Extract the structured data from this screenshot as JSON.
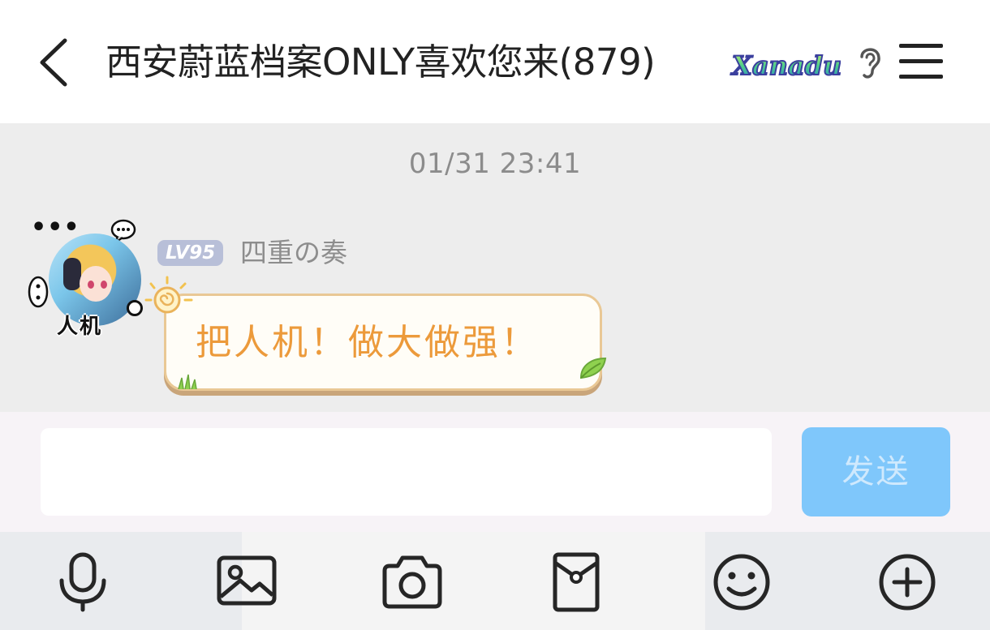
{
  "header": {
    "back_icon": "chevron-left-icon",
    "title": "西安蔚蓝档案ONLY喜欢您来(879)",
    "badge_text": "Xanadu",
    "ear_icon": "ear-icon",
    "menu_icon": "hamburger-menu-icon"
  },
  "chat": {
    "timestamp": "01/31 23:41",
    "messages": [
      {
        "avatar_tag": "人机",
        "level": "LV95",
        "sender": "四重の奏",
        "text": "把人机！做大做强！",
        "text_color": "#ec9a3b"
      }
    ]
  },
  "composer": {
    "input_value": "",
    "send_label": "发送",
    "send_color": "#7fc7fb"
  },
  "toolbar": {
    "items": [
      "microphone-icon",
      "image-icon",
      "camera-icon",
      "red-envelope-icon",
      "emoji-icon",
      "plus-circle-icon"
    ]
  }
}
